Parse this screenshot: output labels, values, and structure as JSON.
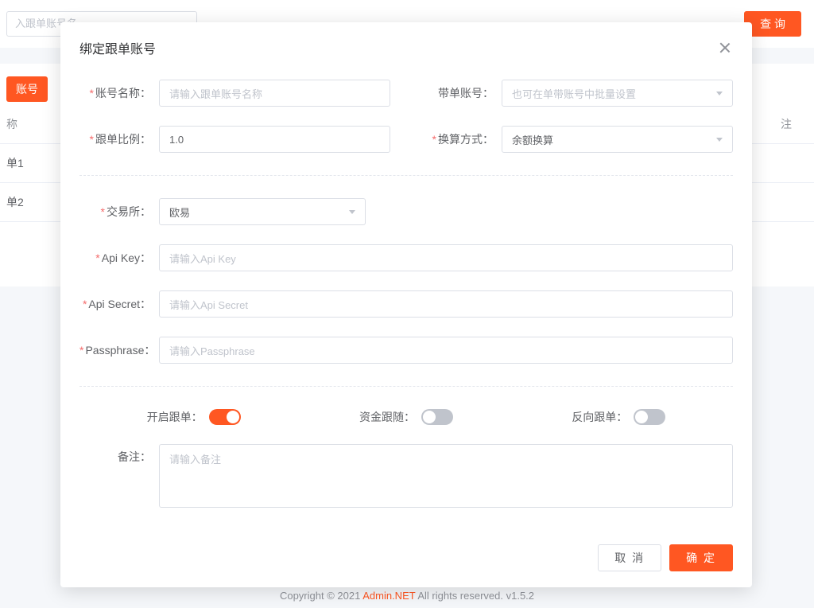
{
  "bg": {
    "searchPlaceholder": "入跟单账号名",
    "queryBtn": "查 询",
    "bindBtn": "账号",
    "colName": "称",
    "colRemark": "注",
    "row1": "单1",
    "row2": "单2"
  },
  "footer": {
    "pre": "Copyright © 2021 ",
    "brand": "Admin.NET",
    "post": " All rights reserved. v1.5.2"
  },
  "dialog": {
    "title": "绑定跟单账号",
    "fields": {
      "accountName": {
        "label": "账号名称",
        "placeholder": "请输入跟单账号名称",
        "required": true
      },
      "leadAccount": {
        "label": "带单账号",
        "placeholder": "也可在单带账号中批量设置",
        "required": false
      },
      "followRatio": {
        "label": "跟单比例",
        "value": "1.0",
        "required": true
      },
      "convertMode": {
        "label": "换算方式",
        "value": "余额换算",
        "required": true
      },
      "exchange": {
        "label": "交易所",
        "value": "欧易",
        "required": true
      },
      "apiKey": {
        "label": "Api Key",
        "placeholder": "请输入Api Key",
        "required": true
      },
      "apiSecret": {
        "label": "Api Secret",
        "placeholder": "请输入Api Secret",
        "required": true
      },
      "passphrase": {
        "label": "Passphrase",
        "placeholder": "请输入Passphrase",
        "required": true
      },
      "remark": {
        "label": "备注",
        "placeholder": "请输入备注",
        "required": false
      }
    },
    "toggles": {
      "enableFollow": {
        "label": "开启跟单：",
        "on": true
      },
      "fundFollow": {
        "label": "资金跟随：",
        "on": false
      },
      "reverseFollow": {
        "label": "反向跟单：",
        "on": false
      }
    },
    "buttons": {
      "cancel": "取 消",
      "confirm": "确 定"
    }
  }
}
